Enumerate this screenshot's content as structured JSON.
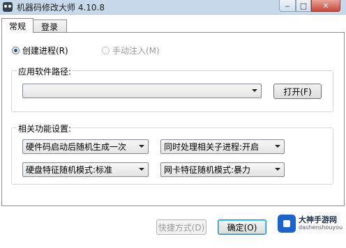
{
  "window": {
    "title": "机器码修改大师 4.10.8",
    "controls": {
      "minimize": "‒",
      "maximize": "□",
      "close": "✕"
    }
  },
  "tabs": [
    {
      "label": "常规",
      "active": true
    },
    {
      "label": "登录",
      "active": false
    }
  ],
  "mode": {
    "create_process": {
      "label": "创建进程(R)",
      "checked": true
    },
    "manual_inject": {
      "label": "手动注入(M)",
      "enabled": false
    }
  },
  "app_path": {
    "group_title": "应用软件路径:",
    "value": "",
    "open_button": "打开(F)"
  },
  "settings": {
    "group_title": "相关功能设置:",
    "hardware_code": "硬件码启动后随机生成一次",
    "child_process": "同时处理相关子进程:开启",
    "disk_mode": "硬盘特征随机模式:标准",
    "nic_mode": "网卡特征随机模式:暴力"
  },
  "footer": {
    "shortcut_button": "快捷方式(D)",
    "ok_button": "确定(O)"
  },
  "watermark": {
    "name": "大神手游网",
    "url": "dashenshouyou"
  }
}
